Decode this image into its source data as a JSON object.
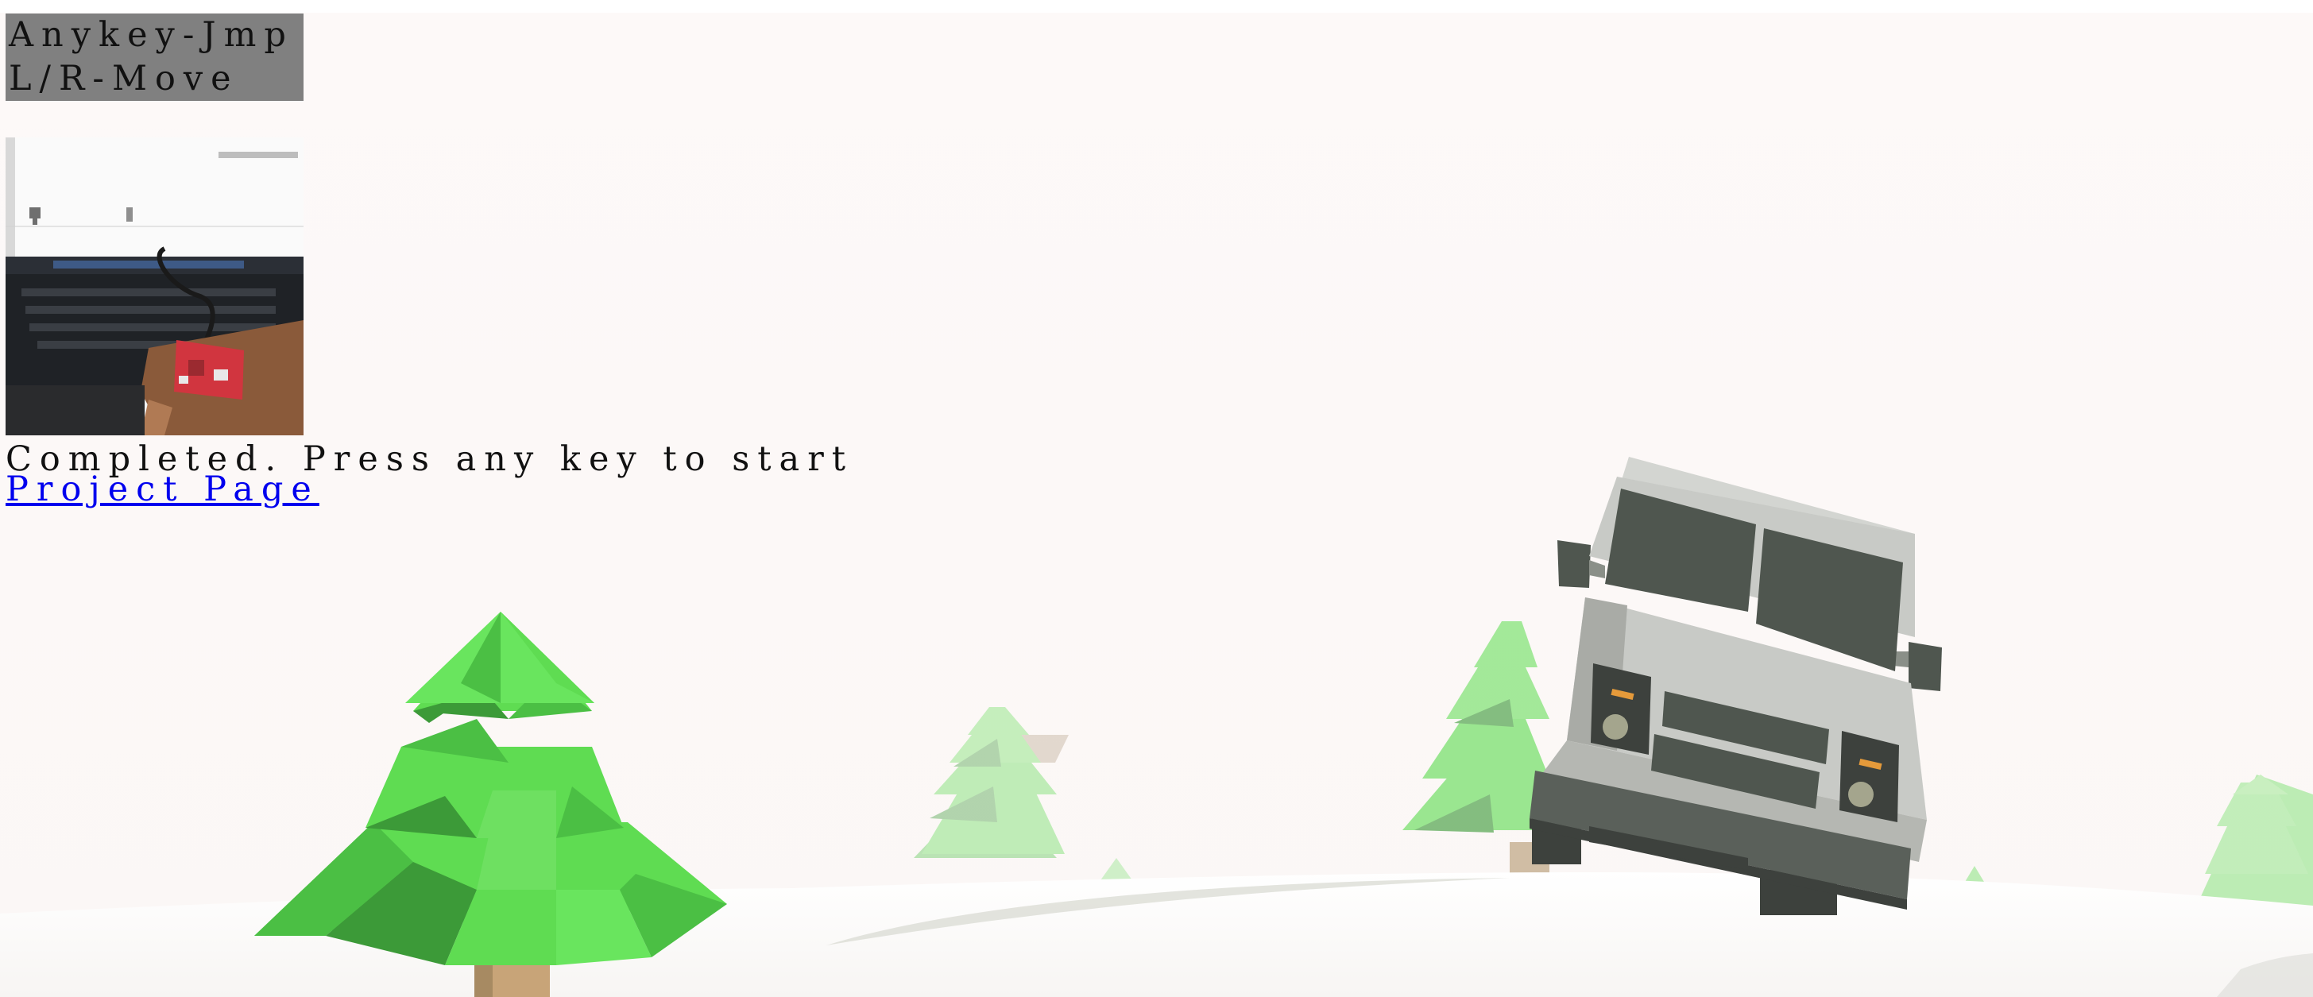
{
  "hud": {
    "line1": "Anykey-Jmp",
    "line2": "L/R-Move"
  },
  "status_text": "Completed. Press any key to start",
  "project_link": "Project Page",
  "colors": {
    "sky": "#fdf9f8",
    "snow": "#ffffff",
    "hud_background": "#808080",
    "tree_green": "#5fdc52",
    "tree_green_dark": "#3c9a38",
    "trunk": "#c8a478",
    "truck_body": "#c8cac6",
    "truck_dark": "#4f564f",
    "link": "#0000ee"
  },
  "icons": {
    "preview": "webcam-preview-image",
    "player": "delivery-truck-icon",
    "obstacle": "pine-tree-icon"
  }
}
